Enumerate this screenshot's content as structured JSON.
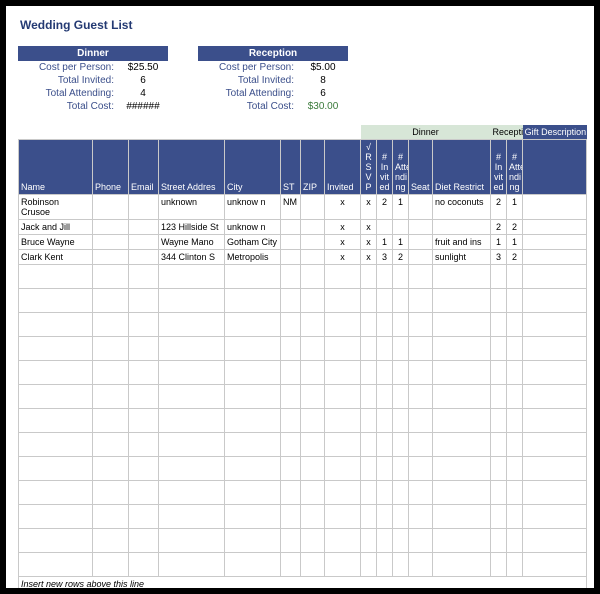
{
  "title": "Wedding Guest List",
  "dinner": {
    "header": "Dinner",
    "rows": {
      "cost_label": "Cost per Person:",
      "cost_value": "$25.50",
      "invited_label": "Total Invited:",
      "invited_value": "6",
      "attend_label": "Total Attending:",
      "attend_value": "4",
      "totalcost_label": "Total Cost:",
      "totalcost_value": "######"
    }
  },
  "reception": {
    "header": "Reception",
    "rows": {
      "cost_label": "Cost per Person:",
      "cost_value": "$5.00",
      "invited_label": "Total Invited:",
      "invited_value": "8",
      "attend_label": "Total Attending:",
      "attend_value": "6",
      "totalcost_label": "Total Cost:",
      "totalcost_value": "$30.00"
    }
  },
  "groups": {
    "dinner": "Dinner",
    "reception": "Recepti",
    "gift": "Gift Description"
  },
  "cols": {
    "name": "Name",
    "phone": "Phone",
    "email": "Email",
    "street": "Street Addres",
    "city": "City",
    "st": "ST",
    "zip": "ZIP",
    "invited": "Invited",
    "rsvp": "√ R S V P",
    "d_inv": "# In vit ed",
    "d_att": "# Atte ndi ng",
    "seat": "Seat",
    "diet": "Diet Restrict",
    "r_inv": "# In vit ed",
    "r_att": "# Atte ndi ng"
  },
  "rows": [
    {
      "name": "Robinson Crusoe",
      "street": "unknown",
      "city": "unknow n",
      "st": "NM",
      "invited": "x",
      "rsvp": "x",
      "d_inv": "2",
      "d_att": "1",
      "diet": "no coconuts",
      "r_inv": "2",
      "r_att": "1"
    },
    {
      "name": "Jack and Jill",
      "street": "123 Hillside St",
      "city": "unknow n",
      "invited": "x",
      "rsvp": "x",
      "r_inv": "2",
      "r_att": "2"
    },
    {
      "name": "Bruce Wayne",
      "street": "Wayne Mano",
      "city": "Gotham City",
      "invited": "x",
      "rsvp": "x",
      "d_inv": "1",
      "d_att": "1",
      "diet": "fruit and ins",
      "r_inv": "1",
      "r_att": "1"
    },
    {
      "name": "Clark Kent",
      "street": "344 Clinton S",
      "city": "Metropolis",
      "invited": "x",
      "rsvp": "x",
      "d_inv": "3",
      "d_att": "2",
      "diet": "sunlight",
      "r_inv": "3",
      "r_att": "2"
    }
  ],
  "footer": "Insert new rows above this line"
}
